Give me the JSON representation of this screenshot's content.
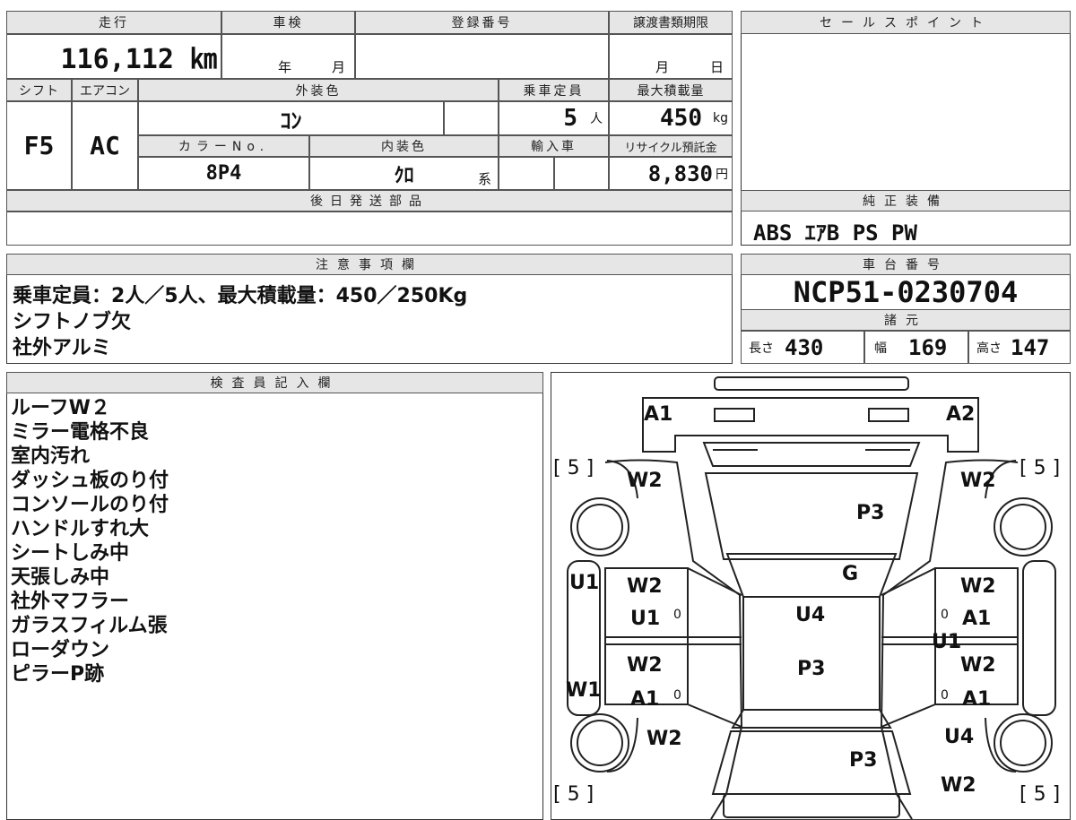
{
  "top_row": {
    "mileage_label": "走行",
    "mileage_value": "116,112 ㎞",
    "inspection_label": "車検",
    "inspection_year": "年",
    "inspection_month": "月",
    "reg_label": "登録番号",
    "transfer_label": "譲渡書類期限",
    "transfer_month": "月",
    "transfer_day": "日"
  },
  "row2": {
    "shift_label": "シフト",
    "ac_label": "エアコン",
    "color_label": "外装色",
    "capacity_label": "乗車定員",
    "maxload_label": "最大積載量",
    "shift_value": "F5",
    "ac_value": "AC",
    "color_value": "ｺﾝ",
    "capacity_value": "5",
    "capacity_unit": "人",
    "maxload_value": "450",
    "maxload_unit": "kg",
    "colorno_label": "カラーNo.",
    "interior_label": "内装色",
    "import_label": "輸入車",
    "recycle_label": "リサイクル預託金",
    "colorno_value": "8P4",
    "interior_value": "ｸﾛ",
    "interior_unit": "系",
    "recycle_value": "8,830",
    "recycle_unit": "円",
    "later_parts_label": "後日発送部品"
  },
  "sales_point": {
    "label": "セールスポイント"
  },
  "equipment": {
    "label": "純正装備",
    "value": "ABS ｴｱB PS PW"
  },
  "notes": {
    "label": "注意事項欄",
    "lines": [
      "乗車定員：2人／5人、最大積載量：450／250Kg",
      "シフトノブ欠",
      "社外アルミ"
    ]
  },
  "chassis": {
    "label": "車台番号",
    "value": "NCP51-0230704",
    "spec_label": "諸元",
    "length_label": "長さ",
    "length_value": "430",
    "width_label": "幅",
    "width_value": "169",
    "height_label": "高さ",
    "height_value": "147"
  },
  "inspector": {
    "label": "検査員記入欄",
    "lines": [
      "ルーフW２",
      "ミラー電格不良",
      "室内汚れ",
      "ダッシュ板のり付",
      "コンソールのり付",
      "ハンドルすれ大",
      "シートしみ中",
      "天張しみ中",
      "社外マフラー",
      "ガラスフィルム張",
      "ローダウン",
      "ピラーP跡"
    ]
  },
  "diagram": {
    "labels": {
      "a1_top": "A1",
      "a2_top": "A2",
      "w2_fl": "W2",
      "w2_fr": "W2",
      "p3_hood": "P3",
      "g_glass": "G",
      "u1_left": "U1",
      "w2_l1": "W2",
      "u1_l1": "U1",
      "u4_roof": "U4",
      "w2_r1": "W2",
      "a1_r1": "A1",
      "u1_r1": "U1",
      "w1_left": "W1",
      "w2_l2": "W2",
      "a1_l2": "A1",
      "p3_roof": "P3",
      "w2_r2": "W2",
      "a1_r2": "A1",
      "w2_rl": "W2",
      "u4_rr": "U4",
      "p3_trunk": "P3",
      "w2_rr": "W2",
      "tire_fl": "[ 5 ]",
      "tire_fr": "[ 5 ]",
      "tire_rl": "[ 5 ]",
      "tire_rr": "[ 5 ]",
      "zero": "0"
    }
  }
}
